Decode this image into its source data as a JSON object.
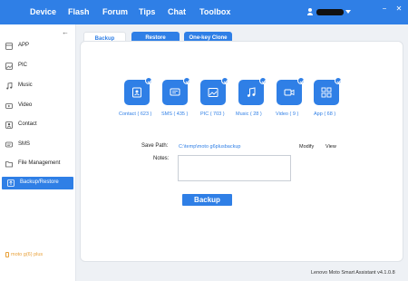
{
  "topbar": {
    "nav": [
      {
        "label": "Device"
      },
      {
        "label": "Flash"
      },
      {
        "label": "Forum"
      },
      {
        "label": "Tips"
      },
      {
        "label": "Chat"
      },
      {
        "label": "Toolbox"
      }
    ],
    "controls": {
      "minimize": "−",
      "close": "✕"
    }
  },
  "sidebar": {
    "items": [
      {
        "label": "APP",
        "icon": "app-icon"
      },
      {
        "label": "PIC",
        "icon": "picture-icon"
      },
      {
        "label": "Music",
        "icon": "music-icon"
      },
      {
        "label": "Video",
        "icon": "video-icon"
      },
      {
        "label": "Contact",
        "icon": "contact-icon"
      },
      {
        "label": "SMS",
        "icon": "sms-icon"
      },
      {
        "label": "File Management",
        "icon": "folder-icon"
      },
      {
        "label": "Backup/Restore",
        "icon": "backup-icon",
        "active": true
      }
    ],
    "device_name": "moto g(6) plus"
  },
  "tabs": [
    {
      "label": "Backup",
      "active": true
    },
    {
      "label": "Restore",
      "active": false
    },
    {
      "label": "One-key Clone",
      "active": false
    }
  ],
  "categories": [
    {
      "label": "Contact ( 623 )",
      "icon": "contact-book-icon",
      "checked": true
    },
    {
      "label": "SMS ( 435 )",
      "icon": "sms-icon",
      "checked": true
    },
    {
      "label": "PIC ( 703 )",
      "icon": "picture-icon",
      "checked": true
    },
    {
      "label": "Music ( 28 )",
      "icon": "music-note-icon",
      "checked": true
    },
    {
      "label": "Video ( 9 )",
      "icon": "video-camera-icon",
      "checked": true
    },
    {
      "label": "App ( 68 )",
      "icon": "app-grid-icon",
      "checked": true
    }
  ],
  "form": {
    "save_path_label": "Save Path:",
    "save_path_value": "C:\\temp\\moto g6plusbackup",
    "modify_label": "Modify",
    "view_label": "View",
    "notes_label": "Notes:",
    "notes_value": "",
    "backup_button": "Backup"
  },
  "footer": {
    "version": "Lenovo Moto Smart Assistant v4.1.0.8"
  },
  "colors": {
    "accent": "#2f7fe6",
    "device": "#e8a13a"
  }
}
